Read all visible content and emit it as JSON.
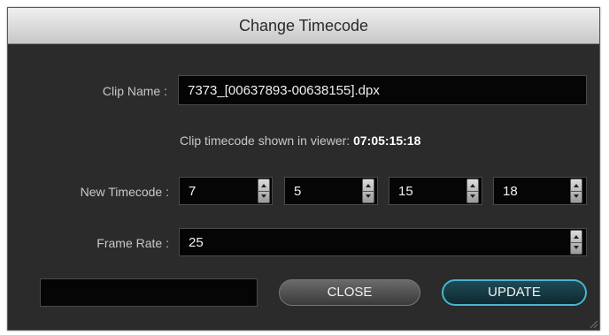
{
  "dialog": {
    "title": "Change Timecode",
    "clip_name_label": "Clip Name :",
    "clip_name_value": "7373_[00637893-00638155].dpx",
    "viewer_prefix": "Clip timecode shown in viewer:",
    "viewer_timecode": "07:05:15:18",
    "new_timecode_label": "New Timecode :",
    "timecode_fields": [
      "7",
      "5",
      "15",
      "18"
    ],
    "frame_rate_label": "Frame Rate :",
    "frame_rate_value": "25",
    "status_value": "",
    "close_label": "CLOSE",
    "update_label": "UPDATE"
  },
  "colors": {
    "dialog_bg": "#2b2b2b",
    "field_bg": "#050505",
    "update_border": "#46b6cf"
  }
}
